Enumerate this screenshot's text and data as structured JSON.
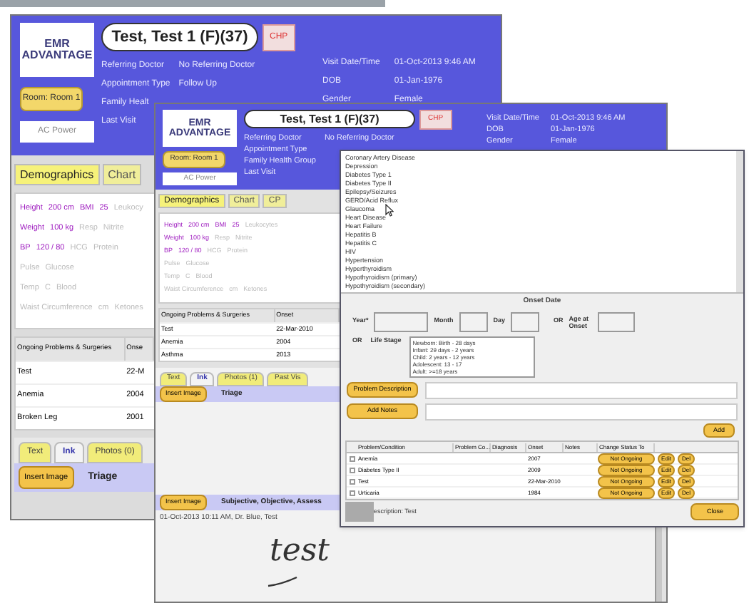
{
  "back_window": {
    "logo": "EMR ADVANTAGE",
    "patient_name": "Test, Test 1 (F)(37)",
    "chp_button": "CHP",
    "room_button": "Room: Room 1",
    "power_label": "AC Power",
    "left_fields": [
      {
        "label": "Referring Doctor",
        "value": "No Referring Doctor"
      },
      {
        "label": "Appointment Type",
        "value": "Follow Up"
      },
      {
        "label": "Family Healt"
      },
      {
        "label": "Last Visit"
      }
    ],
    "right_fields": [
      {
        "label": "Visit Date/Time",
        "value": "01-Oct-2013  9:46 AM"
      },
      {
        "label": "DOB",
        "value": "01-Jan-1976"
      },
      {
        "label": "Gender",
        "value": "Female"
      }
    ],
    "tabs": [
      {
        "label": "Demographics",
        "selected": true
      },
      {
        "label": "Chart",
        "selected": false
      }
    ],
    "vitals": [
      [
        {
          "text": "Height",
          "filled": true
        },
        {
          "text": "200 cm",
          "filled": true
        },
        {
          "text": "BMI",
          "filled": true
        },
        {
          "text": "25",
          "filled": true
        },
        {
          "text": "Leukocy",
          "filled": false
        }
      ],
      [
        {
          "text": "Weight",
          "filled": true
        },
        {
          "text": "100 kg",
          "filled": true
        },
        {
          "text": "Resp",
          "filled": false
        },
        {
          "text": "Nitrite",
          "filled": false
        }
      ],
      [
        {
          "text": "BP",
          "filled": true
        },
        {
          "text": "120 / 80",
          "filled": true
        },
        {
          "text": "HCG",
          "filled": false
        },
        {
          "text": "Protein",
          "filled": false
        }
      ],
      [
        {
          "text": "Pulse",
          "filled": false
        },
        {
          "text": "Glucose",
          "filled": false
        }
      ],
      [
        {
          "text": "Temp",
          "filled": false
        },
        {
          "text": "C",
          "filled": false
        },
        {
          "text": "Blood",
          "filled": false
        }
      ],
      [
        {
          "text": "Waist Circumference",
          "filled": false
        },
        {
          "text": "cm",
          "filled": false
        },
        {
          "text": "Ketones",
          "filled": false
        }
      ]
    ],
    "problems": {
      "columns": [
        "Ongoing Problems & Surgeries",
        "Onse"
      ],
      "rows": [
        [
          "Test",
          "22-M"
        ],
        [
          "Anemia",
          "2004"
        ],
        [
          "Broken Leg",
          "2001"
        ]
      ]
    },
    "note_tabs": [
      {
        "label": "Text",
        "selected": false
      },
      {
        "label": "Ink",
        "selected": true
      },
      {
        "label": "Photos (0)",
        "selected": false
      }
    ],
    "sections": [
      {
        "button": "Insert Image",
        "title": "Triage"
      }
    ]
  },
  "middle_window": {
    "logo": "EMR ADVANTAGE",
    "patient_name": "Test, Test 1 (F)(37)",
    "chp_button": "CHP",
    "room_button": "Room: Room 1",
    "power_label": "AC Power",
    "left_fields": [
      {
        "label": "Referring Doctor",
        "value": "No Referring Doctor"
      },
      {
        "label": "Appointment Type"
      },
      {
        "label": "Family Health Group"
      },
      {
        "label": "Last Visit"
      }
    ],
    "right_fields": [
      {
        "label": "Visit Date/Time",
        "value": "01-Oct-2013  9:46 AM"
      },
      {
        "label": "DOB",
        "value": "01-Jan-1976"
      },
      {
        "label": "Gender",
        "value": "Female"
      }
    ],
    "tabs": [
      {
        "label": "Demographics",
        "selected": true
      },
      {
        "label": "Chart",
        "selected": false
      },
      {
        "label": "CP",
        "selected": false
      }
    ],
    "vitals": [
      [
        {
          "text": "Height",
          "filled": true
        },
        {
          "text": "200 cm",
          "filled": true
        },
        {
          "text": "BMI",
          "filled": true
        },
        {
          "text": "25",
          "filled": true
        },
        {
          "text": "Leukocytes",
          "filled": false
        }
      ],
      [
        {
          "text": "Weight",
          "filled": true
        },
        {
          "text": "100 kg",
          "filled": true
        },
        {
          "text": "Resp",
          "filled": false
        },
        {
          "text": "Nitrite",
          "filled": false
        }
      ],
      [
        {
          "text": "BP",
          "filled": true
        },
        {
          "text": "120 / 80",
          "filled": true
        },
        {
          "text": "HCG",
          "filled": false
        },
        {
          "text": "Protein",
          "filled": false
        }
      ],
      [
        {
          "text": "Pulse",
          "filled": false
        },
        {
          "text": "Glucose",
          "filled": false
        }
      ],
      [
        {
          "text": "Temp",
          "filled": false
        },
        {
          "text": "C",
          "filled": false
        },
        {
          "text": "Blood",
          "filled": false
        }
      ],
      [
        {
          "text": "Waist Circumference",
          "filled": false
        },
        {
          "text": "cm",
          "filled": false
        },
        {
          "text": "Ketones",
          "filled": false
        }
      ]
    ],
    "problems": {
      "columns": [
        "Ongoing Problems & Surgeries",
        "Onset"
      ],
      "rows": [
        [
          "Test",
          "22-Mar-2010"
        ],
        [
          "Anemia",
          "2004"
        ],
        [
          "Asthma",
          "2013"
        ]
      ]
    },
    "note_tabs": [
      {
        "label": "Text",
        "selected": false
      },
      {
        "label": "Ink",
        "selected": true
      },
      {
        "label": "Photos (1)",
        "selected": false
      },
      {
        "label": "Past Vis",
        "selected": false
      }
    ],
    "sections": [
      {
        "button": "Insert Image",
        "title": "Triage"
      },
      {
        "button": "Insert Image",
        "title": "Subjective, Objective, Assess",
        "note": "01-Oct-2013 10:11 AM, Dr. Blue, Test",
        "ink": "test"
      }
    ]
  },
  "dialog": {
    "conditions": [
      "Coronary Artery Disease",
      "Depression",
      "Diabetes Type 1",
      "Diabetes Type II",
      "Epilepsy/Seizures",
      "GERD/Acid Reflux",
      "Glaucoma",
      "Heart Disease",
      "Heart Failure",
      "Hepatitis B",
      "Hepatitis C",
      "HIV",
      "Hypertension",
      "Hyperthyroidism",
      "Hypothyroidism (primary)",
      "Hypothyroidism (secondary)"
    ],
    "onset_title": "Onset Date",
    "date_fields": [
      "Year*",
      "Month",
      "Day"
    ],
    "or_label": "OR",
    "life_stage_or_label": "OR",
    "age_label": "Age at Onset",
    "life_stage_label": "Life Stage",
    "life_stages": [
      "Newborn: Birth - 28 days",
      "Infant: 29 days - 2 years",
      "Child: 2 years - 12 years",
      "Adolescent: 13 - 17",
      "Adult: >=18 years"
    ],
    "description_button": "Problem Description",
    "notes_button": "Add Notes",
    "add_button": "Add",
    "columns": [
      "Problem/Condition",
      "Problem Co...",
      "Diagnosis",
      "Onset",
      "Notes",
      "Change Status To"
    ],
    "rows": [
      {
        "condition": "Anemia",
        "onset": "2007",
        "checked": false,
        "status_button": "Not Ongoing",
        "edit_button": "Edit",
        "delete_button": "Del"
      },
      {
        "condition": "Diabetes Type II",
        "onset": "2009",
        "checked": false,
        "status_button": "Not Ongoing",
        "edit_button": "Edit",
        "delete_button": "Del"
      },
      {
        "condition": "Test",
        "onset": "22-Mar-2010",
        "checked": false,
        "status_button": "Not Ongoing",
        "edit_button": "Edit",
        "delete_button": "Del"
      },
      {
        "condition": "Urticaria",
        "onset": "1984",
        "checked": false,
        "status_button": "Not Ongoing",
        "edit_button": "Edit",
        "delete_button": "Del"
      }
    ],
    "footer_text": "escription: Test",
    "close_button": "Close"
  }
}
